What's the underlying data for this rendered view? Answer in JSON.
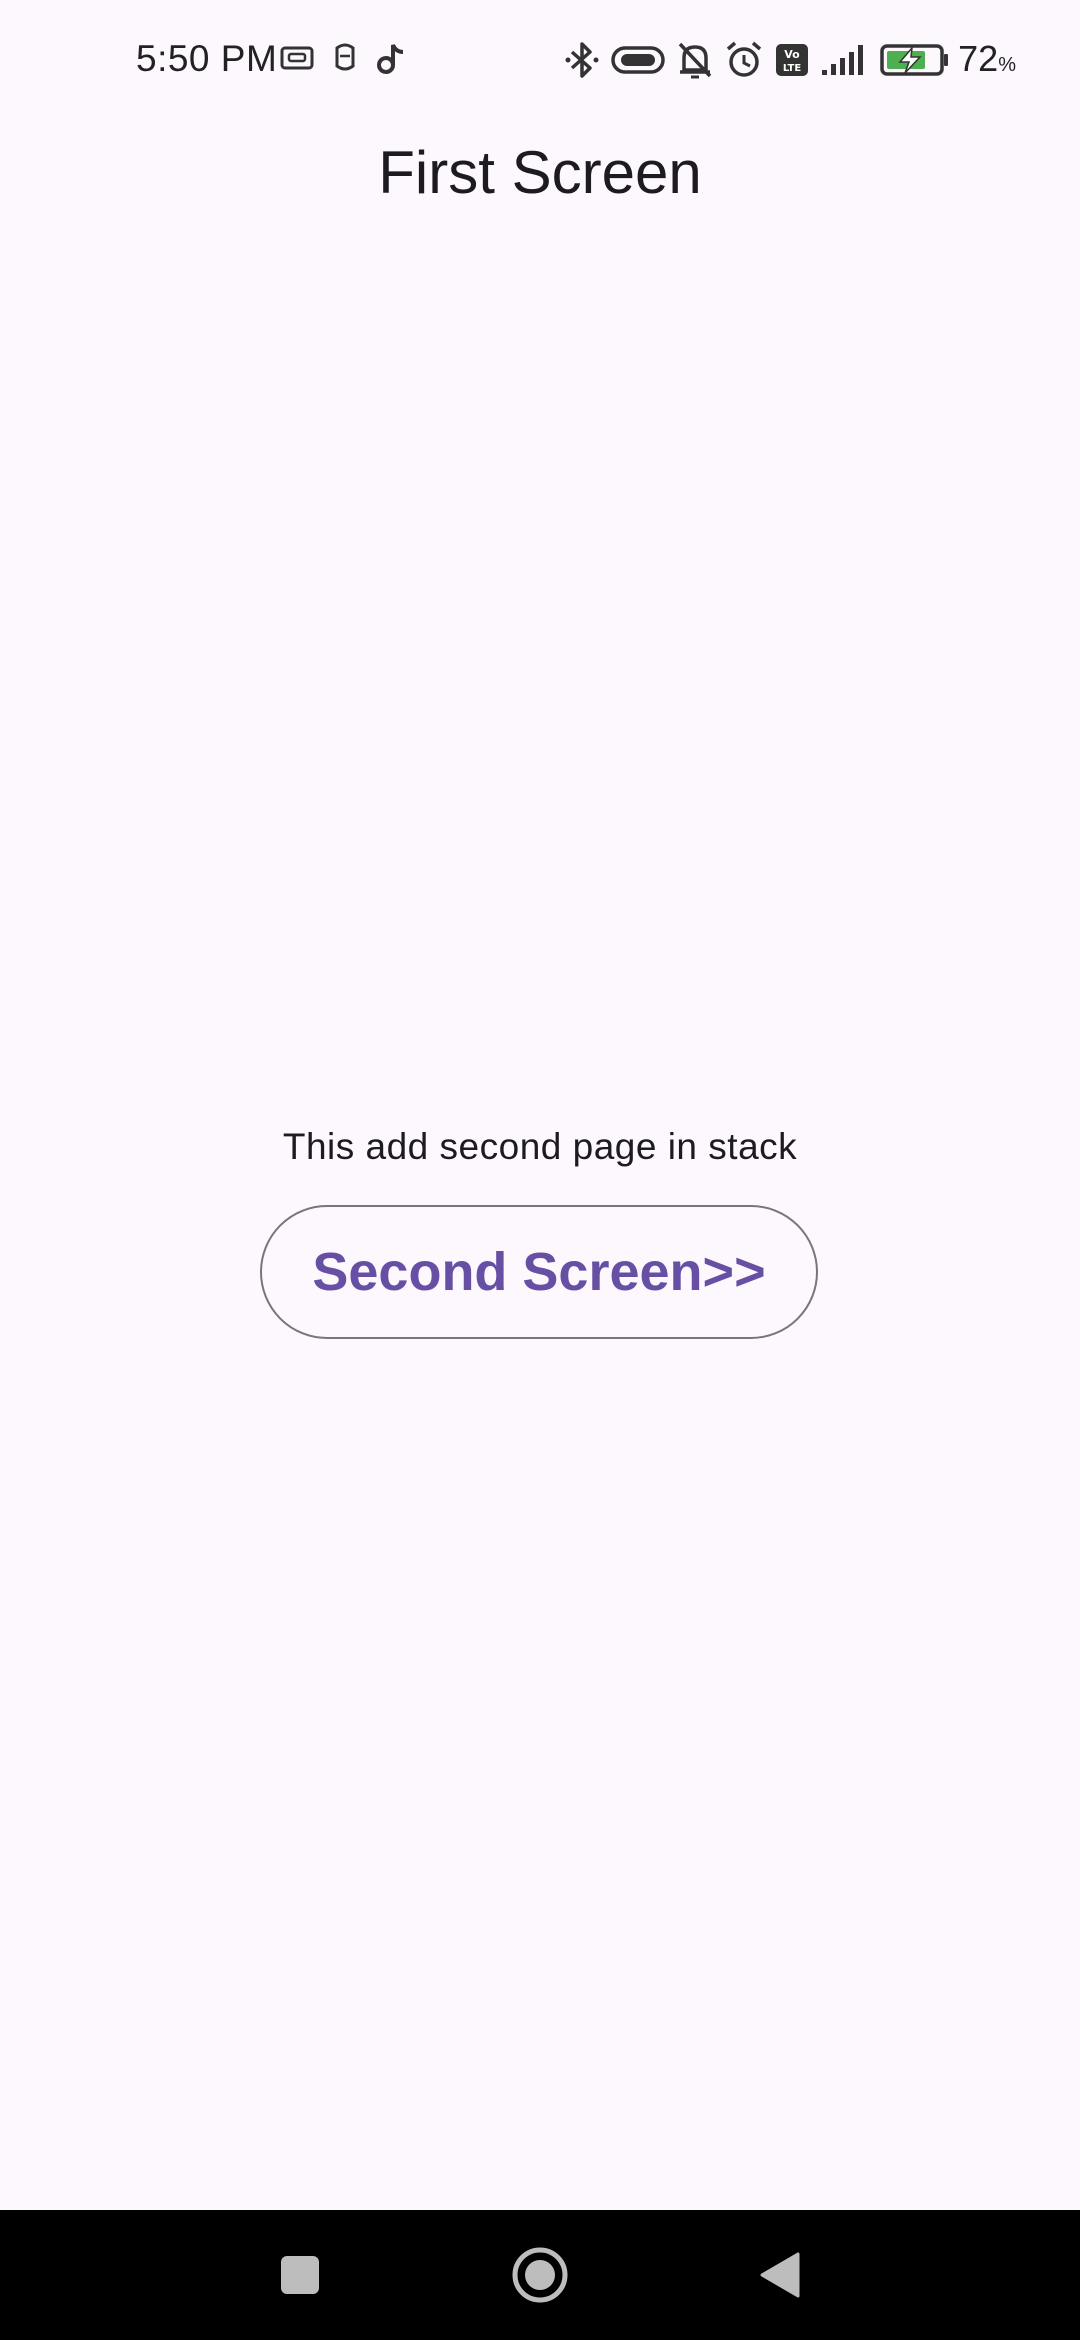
{
  "status_bar": {
    "time": "5:50 PM",
    "battery_value": "72",
    "battery_unit": "%",
    "left_icons": [
      "cast-icon",
      "notification-app-icon",
      "tiktok-icon"
    ],
    "right_icons": [
      "bluetooth-icon",
      "vibrate-icon",
      "mute-icon",
      "alarm-icon",
      "volte-icon",
      "signal-icon",
      "battery-charging-icon"
    ]
  },
  "app": {
    "title": "First Screen"
  },
  "main": {
    "description": "This add second page in stack",
    "button_label": "Second Screen>>"
  },
  "colors": {
    "background": "#fdf7fe",
    "accent": "#6750a4",
    "outline": "#79747e",
    "battery_green": "#4caf50"
  },
  "nav_bar": {
    "icons": [
      "recents-icon",
      "home-icon",
      "back-icon"
    ]
  }
}
